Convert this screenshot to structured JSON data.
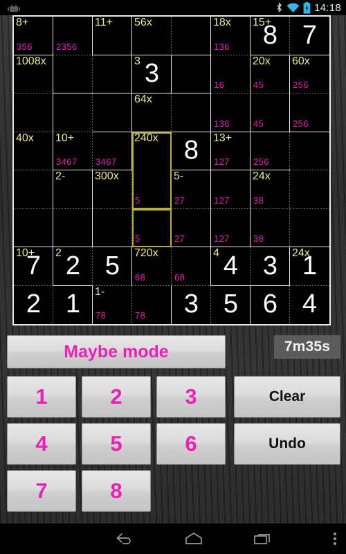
{
  "statusbar": {
    "app_icon": "android-robot-icon",
    "bluetooth_icon": "bluetooth-icon",
    "wifi_icon": "wifi-icon",
    "battery_icon": "battery-charging-icon",
    "clock": "14:18"
  },
  "grid": {
    "size": 8,
    "colors": {
      "cage_label": "#ece9a0",
      "value": "#ffffff",
      "maybe": "#e420b4",
      "border": "#e9e9e9",
      "selected_cage": "#b5b237",
      "background": "#000000"
    },
    "cells": [
      {
        "r": 0,
        "c": 0,
        "cage": "8+",
        "value": "",
        "maybe": "356",
        "right": "solid",
        "bottom": "solid"
      },
      {
        "r": 0,
        "c": 1,
        "cage": "",
        "value": "",
        "maybe": "2356",
        "right": "solid",
        "bottom": "dotted"
      },
      {
        "r": 0,
        "c": 2,
        "cage": "11+",
        "value": "",
        "maybe": "",
        "right": "solid",
        "bottom": "solid"
      },
      {
        "r": 0,
        "c": 3,
        "cage": "56x",
        "value": "",
        "maybe": "",
        "right": "dotted",
        "bottom": "solid"
      },
      {
        "r": 0,
        "c": 4,
        "cage": "",
        "value": "",
        "maybe": "",
        "right": "solid",
        "bottom": "solid"
      },
      {
        "r": 0,
        "c": 5,
        "cage": "18x",
        "value": "",
        "maybe": "136",
        "right": "solid",
        "bottom": "dotted"
      },
      {
        "r": 0,
        "c": 6,
        "cage": "15+",
        "value": "8",
        "maybe": "",
        "right": "dotted",
        "bottom": "solid"
      },
      {
        "r": 0,
        "c": 7,
        "cage": "",
        "value": "7",
        "maybe": "",
        "right": "none",
        "bottom": "solid"
      },
      {
        "r": 1,
        "c": 0,
        "cage": "1008x",
        "value": "",
        "maybe": "",
        "right": "solid",
        "bottom": "dotted"
      },
      {
        "r": 1,
        "c": 1,
        "cage": "",
        "value": "",
        "maybe": "",
        "right": "dotted",
        "bottom": "solid"
      },
      {
        "r": 1,
        "c": 2,
        "cage": "",
        "value": "",
        "maybe": "",
        "right": "solid",
        "bottom": "solid"
      },
      {
        "r": 1,
        "c": 3,
        "cage": "3",
        "value": "3",
        "maybe": "",
        "right": "solid",
        "bottom": "solid"
      },
      {
        "r": 1,
        "c": 4,
        "cage": "",
        "value": "",
        "maybe": "",
        "right": "solid",
        "bottom": "solid"
      },
      {
        "r": 1,
        "c": 5,
        "cage": "",
        "value": "",
        "maybe": "16",
        "right": "solid",
        "bottom": "dotted"
      },
      {
        "r": 1,
        "c": 6,
        "cage": "20x",
        "value": "",
        "maybe": "45",
        "right": "solid",
        "bottom": "dotted"
      },
      {
        "r": 1,
        "c": 7,
        "cage": "60x",
        "value": "",
        "maybe": "256",
        "right": "none",
        "bottom": "dotted"
      },
      {
        "r": 2,
        "c": 0,
        "cage": "",
        "value": "",
        "maybe": "",
        "right": "solid",
        "bottom": "dotted"
      },
      {
        "r": 2,
        "c": 1,
        "cage": "",
        "value": "",
        "maybe": "",
        "right": "dotted",
        "bottom": "dotted"
      },
      {
        "r": 2,
        "c": 2,
        "cage": "",
        "value": "",
        "maybe": "",
        "right": "solid",
        "bottom": "solid"
      },
      {
        "r": 2,
        "c": 3,
        "cage": "64x",
        "value": "",
        "maybe": "",
        "right": "dotted",
        "bottom": "solid"
      },
      {
        "r": 2,
        "c": 4,
        "cage": "",
        "value": "",
        "maybe": "",
        "right": "solid",
        "bottom": "solid"
      },
      {
        "r": 2,
        "c": 5,
        "cage": "",
        "value": "",
        "maybe": "136",
        "right": "solid",
        "bottom": "solid"
      },
      {
        "r": 2,
        "c": 6,
        "cage": "",
        "value": "",
        "maybe": "45",
        "right": "solid",
        "bottom": "solid"
      },
      {
        "r": 2,
        "c": 7,
        "cage": "",
        "value": "",
        "maybe": "256",
        "right": "none",
        "bottom": "solid"
      },
      {
        "r": 3,
        "c": 0,
        "cage": "40x",
        "value": "",
        "maybe": "",
        "right": "solid",
        "bottom": "dotted"
      },
      {
        "r": 3,
        "c": 1,
        "cage": "10+",
        "value": "",
        "maybe": "3467",
        "right": "dotted",
        "bottom": "solid"
      },
      {
        "r": 3,
        "c": 2,
        "cage": "",
        "value": "",
        "maybe": "3467",
        "right": "solid",
        "bottom": "solid"
      },
      {
        "r": 3,
        "c": 3,
        "cage": "240x",
        "value": "",
        "maybe": "",
        "right": "dotted",
        "bottom": "none",
        "sel": "tlr"
      },
      {
        "r": 3,
        "c": 4,
        "cage": "",
        "value": "8",
        "maybe": "",
        "right": "solid",
        "bottom": "solid"
      },
      {
        "r": 3,
        "c": 5,
        "cage": "13+",
        "value": "",
        "maybe": "127",
        "right": "solid",
        "bottom": "solid"
      },
      {
        "r": 3,
        "c": 6,
        "cage": "",
        "value": "",
        "maybe": "256",
        "right": "dotted",
        "bottom": "solid"
      },
      {
        "r": 3,
        "c": 7,
        "cage": "",
        "value": "",
        "maybe": "",
        "right": "none",
        "bottom": "dotted"
      },
      {
        "r": 4,
        "c": 0,
        "cage": "",
        "value": "",
        "maybe": "",
        "right": "solid",
        "bottom": "dotted"
      },
      {
        "r": 4,
        "c": 1,
        "cage": "2-",
        "value": "",
        "maybe": "",
        "right": "solid",
        "bottom": "dotted"
      },
      {
        "r": 4,
        "c": 2,
        "cage": "300x",
        "value": "",
        "maybe": "",
        "right": "dotted",
        "bottom": "dotted"
      },
      {
        "r": 4,
        "c": 3,
        "cage": "",
        "value": "",
        "maybe": "5",
        "right": "dotted",
        "bottom": "none",
        "sel": "lrb"
      },
      {
        "r": 4,
        "c": 4,
        "cage": "5-",
        "value": "",
        "maybe": "27",
        "right": "solid",
        "bottom": "dotted"
      },
      {
        "r": 4,
        "c": 5,
        "cage": "",
        "value": "",
        "maybe": "127",
        "right": "solid",
        "bottom": "dotted"
      },
      {
        "r": 4,
        "c": 6,
        "cage": "24x",
        "value": "",
        "maybe": "38",
        "right": "dotted",
        "bottom": "dotted"
      },
      {
        "r": 4,
        "c": 7,
        "cage": "",
        "value": "",
        "maybe": "",
        "right": "none",
        "bottom": "dotted"
      },
      {
        "r": 5,
        "c": 0,
        "cage": "",
        "value": "",
        "maybe": "",
        "right": "solid",
        "bottom": "solid"
      },
      {
        "r": 5,
        "c": 1,
        "cage": "",
        "value": "",
        "maybe": "",
        "right": "solid",
        "bottom": "solid"
      },
      {
        "r": 5,
        "c": 2,
        "cage": "",
        "value": "",
        "maybe": "",
        "right": "dotted",
        "bottom": "solid"
      },
      {
        "r": 5,
        "c": 3,
        "cage": "",
        "value": "",
        "maybe": "5",
        "right": "dotted",
        "bottom": "solid",
        "sel": "tlrb"
      },
      {
        "r": 5,
        "c": 4,
        "cage": "",
        "value": "",
        "maybe": "27",
        "right": "solid",
        "bottom": "solid"
      },
      {
        "r": 5,
        "c": 5,
        "cage": "",
        "value": "",
        "maybe": "127",
        "right": "solid",
        "bottom": "solid"
      },
      {
        "r": 5,
        "c": 6,
        "cage": "",
        "value": "",
        "maybe": "38",
        "right": "dotted",
        "bottom": "solid"
      },
      {
        "r": 5,
        "c": 7,
        "cage": "",
        "value": "",
        "maybe": "",
        "right": "none",
        "bottom": "solid"
      },
      {
        "r": 6,
        "c": 0,
        "cage": "10+",
        "value": "7",
        "maybe": "",
        "right": "solid",
        "bottom": "dotted"
      },
      {
        "r": 6,
        "c": 1,
        "cage": "2",
        "value": "2",
        "maybe": "",
        "right": "dotted",
        "bottom": "solid"
      },
      {
        "r": 6,
        "c": 2,
        "cage": "",
        "value": "5",
        "maybe": "",
        "right": "solid",
        "bottom": "dotted"
      },
      {
        "r": 6,
        "c": 3,
        "cage": "720x",
        "value": "",
        "maybe": "68",
        "right": "dotted",
        "bottom": "dotted"
      },
      {
        "r": 6,
        "c": 4,
        "cage": "",
        "value": "",
        "maybe": "68",
        "right": "solid",
        "bottom": "dotted"
      },
      {
        "r": 6,
        "c": 5,
        "cage": "4",
        "value": "4",
        "maybe": "",
        "right": "dotted",
        "bottom": "solid"
      },
      {
        "r": 6,
        "c": 6,
        "cage": "",
        "value": "3",
        "maybe": "",
        "right": "solid",
        "bottom": "solid"
      },
      {
        "r": 6,
        "c": 7,
        "cage": "24x",
        "value": "1",
        "maybe": "",
        "right": "none",
        "bottom": "dotted"
      },
      {
        "r": 7,
        "c": 0,
        "cage": "",
        "value": "2",
        "maybe": "",
        "right": "dotted",
        "bottom": "none"
      },
      {
        "r": 7,
        "c": 1,
        "cage": "",
        "value": "1",
        "maybe": "",
        "right": "solid",
        "bottom": "none"
      },
      {
        "r": 7,
        "c": 2,
        "cage": "1-",
        "value": "",
        "maybe": "78",
        "right": "dotted",
        "bottom": "none"
      },
      {
        "r": 7,
        "c": 3,
        "cage": "",
        "value": "",
        "maybe": "78",
        "right": "solid",
        "bottom": "none"
      },
      {
        "r": 7,
        "c": 4,
        "cage": "",
        "value": "3",
        "maybe": "",
        "right": "dotted",
        "bottom": "none"
      },
      {
        "r": 7,
        "c": 5,
        "cage": "",
        "value": "5",
        "maybe": "",
        "right": "solid",
        "bottom": "none"
      },
      {
        "r": 7,
        "c": 6,
        "cage": "",
        "value": "6",
        "maybe": "",
        "right": "dotted",
        "bottom": "none"
      },
      {
        "r": 7,
        "c": 7,
        "cage": "",
        "value": "4",
        "maybe": "",
        "right": "none",
        "bottom": "none"
      }
    ]
  },
  "controls": {
    "maybe_mode_label": "Maybe mode",
    "timer": "7m35s",
    "clear_label": "Clear",
    "undo_label": "Undo",
    "digits": [
      "1",
      "2",
      "3",
      "4",
      "5",
      "6",
      "7",
      "8"
    ]
  },
  "navbar": {
    "back_icon": "back-arrow-icon",
    "home_icon": "home-icon",
    "recents_icon": "recents-icon",
    "overflow_icon": "overflow-menu-icon"
  }
}
